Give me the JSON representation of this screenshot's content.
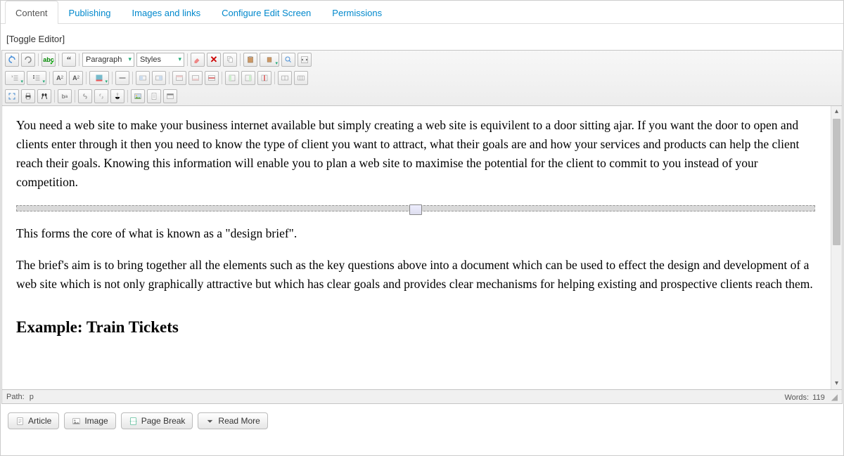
{
  "tabs": [
    {
      "label": "Content",
      "active": true
    },
    {
      "label": "Publishing",
      "active": false
    },
    {
      "label": "Images and links",
      "active": false
    },
    {
      "label": "Configure Edit Screen",
      "active": false
    },
    {
      "label": "Permissions",
      "active": false
    }
  ],
  "toggle_editor_label": "[Toggle Editor]",
  "toolbar": {
    "paragraph_label": "Paragraph",
    "styles_label": "Styles"
  },
  "content": {
    "para1": "You need a web site to make your business internet available but simply creating a web site is equivilent to a door sitting ajar. If you want the door to open and  clients enter through it then you need to know the type of client you want to attract, what their goals are and how your services and products can help the client reach their goals. Knowing this information will enable you to plan a web site to maximise the potential for the client to commit to you instead of your competition.",
    "para2": "This forms the core of what is known as a \"design brief\".",
    "para3": " The brief's aim is to bring together all the elements such as the key questions above into a document which can be used to effect the design and development of a web site which is not only graphically attractive but which has clear goals and provides clear mechanisms for helping existing and prospective clients reach them.",
    "heading": "Example: Train Tickets"
  },
  "statusbar": {
    "path_label": "Path:",
    "path_value": "p",
    "words_label": "Words:",
    "words_count": "119"
  },
  "bottom_buttons": {
    "article": "Article",
    "image": "Image",
    "page_break": "Page Break",
    "read_more": "Read More"
  }
}
